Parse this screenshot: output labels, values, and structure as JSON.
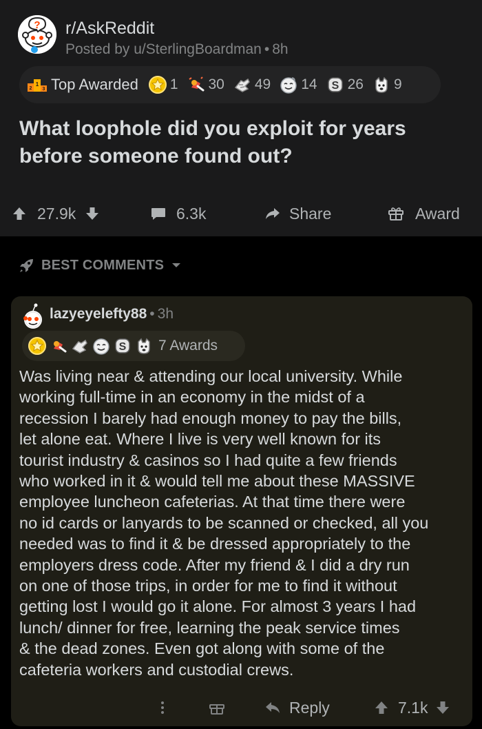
{
  "post": {
    "subreddit": "r/AskReddit",
    "byline_prefix": "Posted by",
    "author": "u/SterlingBoardman",
    "age": "8h",
    "awards_bar": {
      "label": "Top Awarded",
      "awards": [
        {
          "icon": "gold-star-award-icon",
          "count": "1"
        },
        {
          "icon": "wholesome-seal-award-icon",
          "count": "30"
        },
        {
          "icon": "helpful-hand-award-icon",
          "count": "49"
        },
        {
          "icon": "silver-face-award-icon",
          "count": "14"
        },
        {
          "icon": "bless-up-award-icon",
          "count": "26"
        },
        {
          "icon": "doggo-award-icon",
          "count": "9"
        }
      ]
    },
    "title": "What loophole did you exploit for years before someone found out?",
    "actions": {
      "score": "27.9k",
      "comments": "6.3k",
      "share": "Share",
      "award": "Award"
    }
  },
  "sort": {
    "label": "BEST COMMENTS"
  },
  "comment": {
    "author": "lazyeyelefty88",
    "age": "3h",
    "awards_label": "7 Awards",
    "award_icons": [
      "gold-star-award-icon",
      "wholesome-seal-award-icon",
      "helpful-hand-award-icon",
      "silver-face-award-icon",
      "bless-up-award-icon",
      "doggo-award-icon"
    ],
    "body": "Was living near & attending our local university. While\nworking full-time in an economy in the midst of a\nrecession I barely had enough money to pay the bills,\nlet alone eat. Where I live is very well known for its\ntourist industry & casinos so I had quite a few friends\nwho worked in it & would tell me about these MASSIVE\nemployee luncheon cafeterias. At that time there were\nno id cards or lanyards to be scanned or checked, all you\nneeded was to find it & be dressed appropriately to the\nemployers dress code. After my friend & I did a dry run\non one of those trips, in order for me to find it without\ngetting lost I would go it alone. For almost 3 years I had\nlunch/ dinner for free, learning the peak service times\n& the dead zones. Even got along with some of the\ncafeteria workers and custodial crews.",
    "reply_label": "Reply",
    "score": "7.1k"
  },
  "colors": {
    "background": "#000000",
    "card": "#1a1a1b",
    "comment_card": "#1f1e16",
    "text": "#d7dadc",
    "muted": "#818384"
  }
}
